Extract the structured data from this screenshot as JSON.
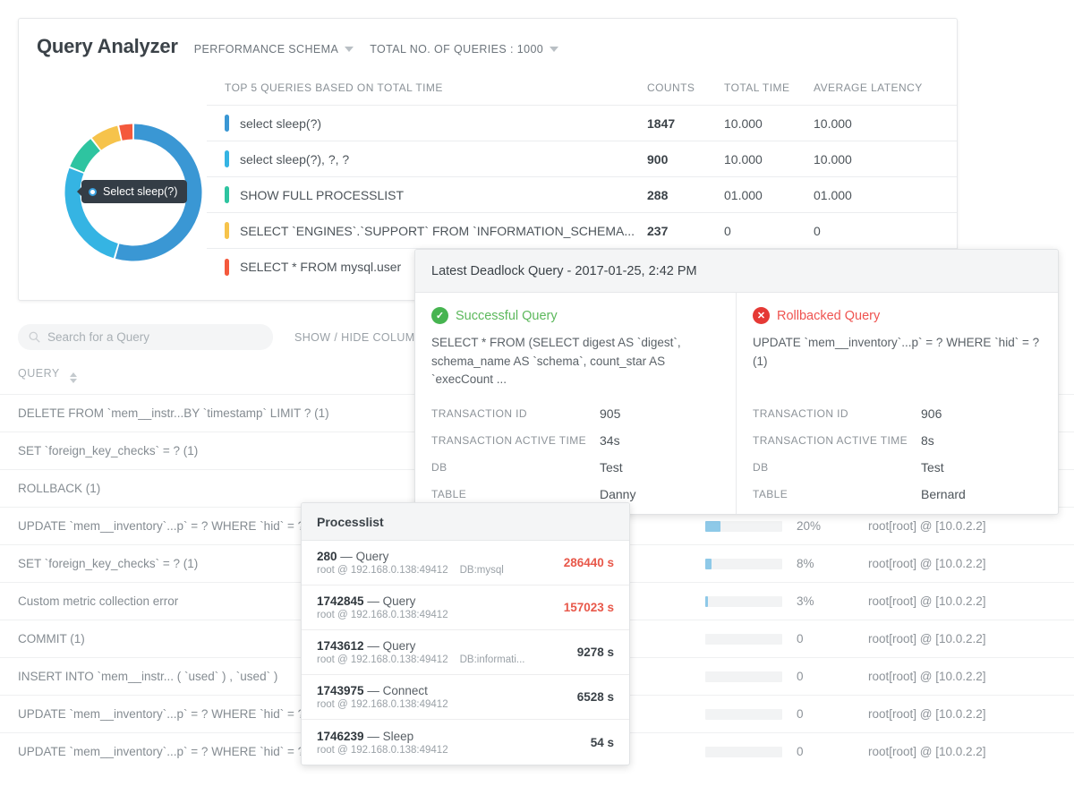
{
  "header": {
    "title": "Query Analyzer",
    "schema_dropdown": "PERFORMANCE SCHEMA",
    "total_queries_dropdown": "TOTAL NO. OF QUERIES : 1000"
  },
  "donut": {
    "tooltip_label": "Select sleep(?)",
    "segments": [
      {
        "label": "select sleep(?)",
        "color": "#3a97d4",
        "value": 1847
      },
      {
        "label": "select sleep(?), ?, ?",
        "color": "#35b4e3",
        "value": 900
      },
      {
        "label": "SHOW FULL PROCESSLIST",
        "color": "#2ec4a0",
        "value": 288
      },
      {
        "label": "SELECT `ENGINES`.`SUPPORT` FROM `INFORMATION_SCHEMA...",
        "color": "#f6c34b",
        "value": 237
      },
      {
        "label": "SELECT * FROM mysql.user",
        "color": "#f4593c",
        "value": 120
      }
    ]
  },
  "top_queries": {
    "columns": {
      "query": "TOP 5 QUERIES BASED ON TOTAL TIME",
      "counts": "COUNTS",
      "total_time": "TOTAL TIME",
      "average_latency": "AVERAGE LATENCY"
    },
    "rows": [
      {
        "color": "#3a97d4",
        "query": "select sleep(?)",
        "counts": "1847",
        "total_time": "10.000",
        "average_latency": "10.000"
      },
      {
        "color": "#35b4e3",
        "query": "select sleep(?), ?, ?",
        "counts": "900",
        "total_time": "10.000",
        "average_latency": "10.000"
      },
      {
        "color": "#2ec4a0",
        "query": "SHOW FULL PROCESSLIST",
        "counts": "288",
        "total_time": "01.000",
        "average_latency": "01.000"
      },
      {
        "color": "#f6c34b",
        "query": "SELECT `ENGINES`.`SUPPORT` FROM `INFORMATION_SCHEMA...",
        "counts": "237",
        "total_time": "0",
        "average_latency": "0"
      },
      {
        "color": "#f4593c",
        "query": "SELECT * FROM mysql.user",
        "counts": "",
        "total_time": "",
        "average_latency": ""
      }
    ]
  },
  "search": {
    "placeholder": "Search for a Query",
    "value": "",
    "show_hide_columns": "SHOW / HIDE COLUMNS"
  },
  "query_table": {
    "column_query": "QUERY",
    "rows": [
      {
        "query": "DELETE FROM `mem__instr...BY `timestamp` LIMIT ? (1)",
        "pct": "",
        "pct_value": 0,
        "host": ""
      },
      {
        "query": "SET `foreign_key_checks` = ? (1)",
        "pct": "",
        "pct_value": 0,
        "host": ""
      },
      {
        "query": "ROLLBACK (1)",
        "pct": "",
        "pct_value": 0,
        "host": ""
      },
      {
        "query": "UPDATE `mem__inventory`...p` = ? WHERE `hid` = ? (1)",
        "pct": "20%",
        "pct_value": 20,
        "host": "root[root] @ [10.0.2.2]"
      },
      {
        "query": "SET `foreign_key_checks` = ? (1)",
        "pct": "8%",
        "pct_value": 8,
        "host": "root[root] @ [10.0.2.2]"
      },
      {
        "query": "Custom metric collection error",
        "pct": "3%",
        "pct_value": 3,
        "host": "root[root] @ [10.0.2.2]"
      },
      {
        "query": "COMMIT (1)",
        "pct": "0",
        "pct_value": 0,
        "host": "root[root] @ [10.0.2.2]"
      },
      {
        "query": "INSERT INTO `mem__instr... ( `used` ) , `used` )",
        "pct": "0",
        "pct_value": 0,
        "host": "root[root] @ [10.0.2.2]"
      },
      {
        "query": "UPDATE `mem__inventory`...p` = ? WHERE `hid` = ? (1)",
        "pct": "0",
        "pct_value": 0,
        "host": "root[root] @ [10.0.2.2]"
      },
      {
        "query": "UPDATE `mem__inventory`...p` = ? WHERE `hid` = ? (1)",
        "pct": "0",
        "pct_value": 0,
        "host": "root[root] @ [10.0.2.2]"
      }
    ]
  },
  "deadlock": {
    "title": "Latest Deadlock Query - 2017-01-25, 2:42 PM",
    "left": {
      "status": "Successful Query",
      "status_icon": "check-circle-icon",
      "status_color": "#5cb85c",
      "sql": "SELECT * FROM (SELECT digest AS `digest`, schema_name AS `schema`, count_star AS `execCount ...",
      "fields": [
        {
          "key": "TRANSACTION ID",
          "value": "905"
        },
        {
          "key": "TRANSACTION ACTIVE TIME",
          "value": "34s"
        },
        {
          "key": "DB",
          "value": "Test"
        },
        {
          "key": "TABLE",
          "value": "Danny"
        }
      ]
    },
    "right": {
      "status": "Rollbacked Query",
      "status_icon": "x-circle-icon",
      "status_color": "#ef5350",
      "sql": "UPDATE `mem__inventory`...p` = ? WHERE `hid` = ? (1)",
      "fields": [
        {
          "key": "TRANSACTION ID",
          "value": "906"
        },
        {
          "key": "TRANSACTION ACTIVE TIME",
          "value": "8s"
        },
        {
          "key": "DB",
          "value": "Test"
        },
        {
          "key": "TABLE",
          "value": "Bernard"
        }
      ]
    }
  },
  "processlist": {
    "title": "Processlist",
    "rows": [
      {
        "id": "280",
        "sep": "—",
        "command": "Query",
        "user": "root @ 192.168.0.138:49412",
        "db": "DB:mysql",
        "time": "286440 s",
        "hot": true
      },
      {
        "id": "1742845",
        "sep": "—",
        "command": "Query",
        "user": "root @ 192.168.0.138:49412",
        "db": "",
        "time": "157023 s",
        "hot": true
      },
      {
        "id": "1743612",
        "sep": "—",
        "command": "Query",
        "user": "root @ 192.168.0.138:49412",
        "db": "DB:informati...",
        "time": "9278 s",
        "hot": false
      },
      {
        "id": "1743975",
        "sep": "—",
        "command": "Connect",
        "user": "root @ 192.168.0.138:49412",
        "db": "",
        "time": "6528 s",
        "hot": false
      },
      {
        "id": "1746239",
        "sep": "—",
        "command": "Sleep",
        "user": "root @ 192.168.0.138:49412",
        "db": "",
        "time": "54 s",
        "hot": false
      }
    ]
  }
}
